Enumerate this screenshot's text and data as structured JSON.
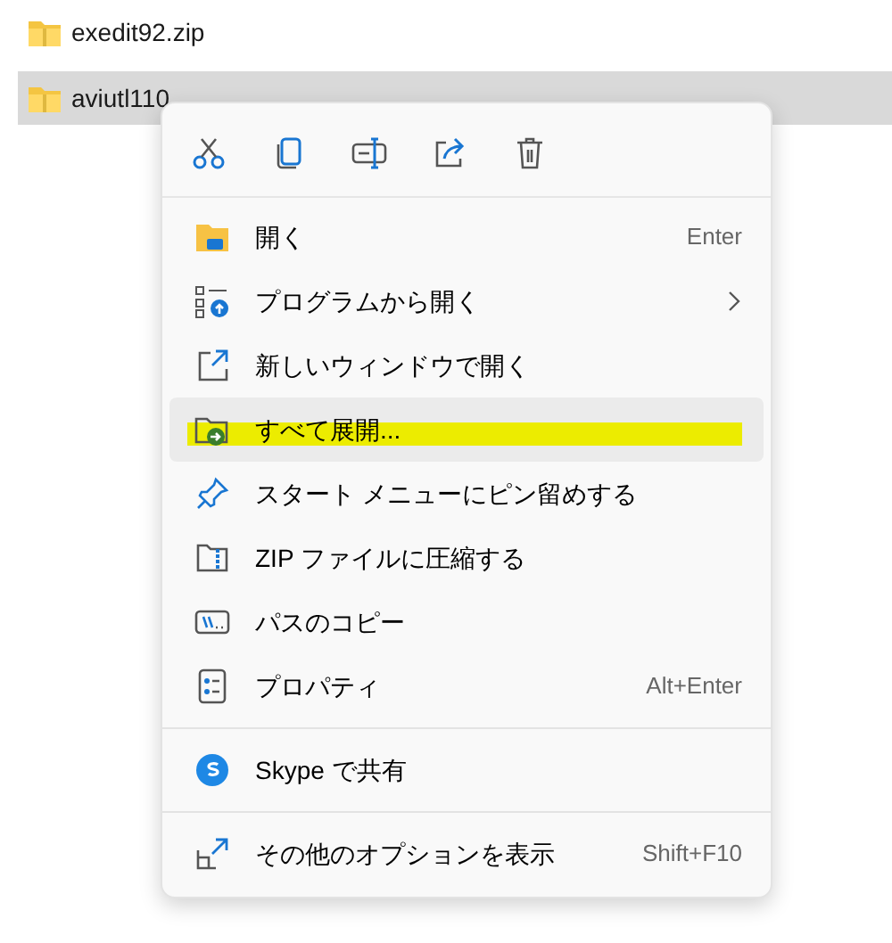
{
  "files": [
    {
      "name": "exedit92.zip",
      "selected": false
    },
    {
      "name": "aviutl110",
      "selected": true
    }
  ],
  "context_menu": {
    "toolbar": [
      {
        "kind": "cut"
      },
      {
        "kind": "copy"
      },
      {
        "kind": "rename"
      },
      {
        "kind": "share"
      },
      {
        "kind": "delete"
      }
    ],
    "items": [
      {
        "kind": "item",
        "label": "開く",
        "shortcut": "Enter",
        "submenu": false,
        "hovered": false,
        "marked": false
      },
      {
        "kind": "item",
        "label": "プログラムから開く",
        "submenu": true,
        "hovered": false,
        "marked": false
      },
      {
        "kind": "item",
        "label": "新しいウィンドウで開く",
        "submenu": false,
        "hovered": false,
        "marked": false
      },
      {
        "kind": "item",
        "label": "すべて展開...",
        "submenu": false,
        "hovered": true,
        "marked": true
      },
      {
        "kind": "item",
        "label": "スタート メニューにピン留めする",
        "submenu": false,
        "hovered": false,
        "marked": false
      },
      {
        "kind": "item",
        "label": "ZIP ファイルに圧縮する",
        "submenu": false,
        "hovered": false,
        "marked": false
      },
      {
        "kind": "item",
        "label": "パスのコピー",
        "submenu": false,
        "hovered": false,
        "marked": false
      },
      {
        "kind": "item",
        "label": "プロパティ",
        "shortcut": "Alt+Enter",
        "submenu": false,
        "hovered": false,
        "marked": false
      },
      {
        "kind": "separator"
      },
      {
        "kind": "item",
        "label": "Skype で共有",
        "submenu": false,
        "hovered": false,
        "marked": false
      },
      {
        "kind": "separator"
      },
      {
        "kind": "item",
        "label": "その他のオプションを表示",
        "shortcut": "Shift+F10",
        "submenu": false,
        "hovered": false,
        "marked": false
      }
    ]
  }
}
